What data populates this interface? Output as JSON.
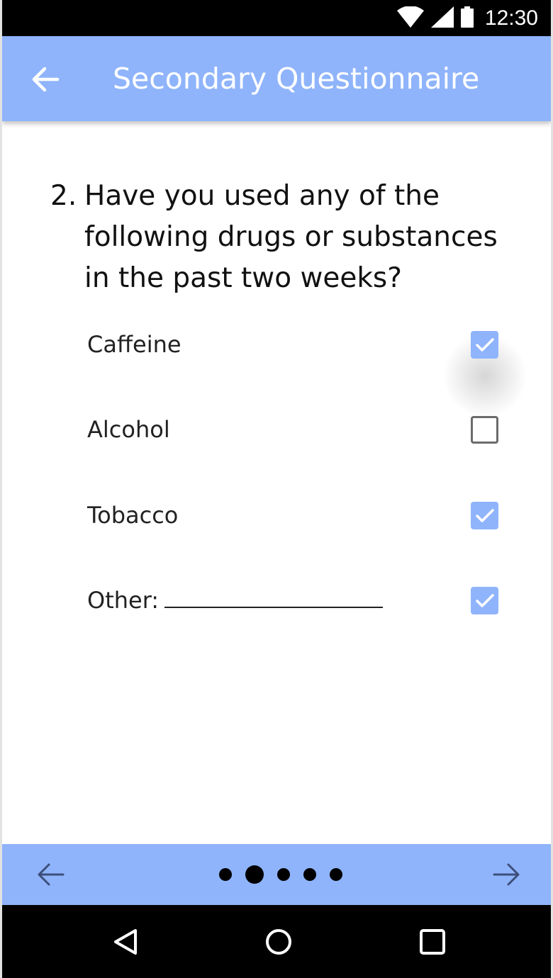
{
  "status_bar": {
    "time": "12:30",
    "icons": [
      "wifi-icon",
      "cellular-signal-icon",
      "battery-icon"
    ]
  },
  "app_bar": {
    "title": "Secondary Questionnaire",
    "back_icon": "arrow-left-icon",
    "color": "#8fb4fb"
  },
  "question": {
    "number": "2.",
    "text": "Have you used any of the following drugs or substances in the past two weeks?"
  },
  "options": [
    {
      "label": "Caffeine",
      "checked": true
    },
    {
      "label": "Alcohol",
      "checked": false
    },
    {
      "label": "Tobacco",
      "checked": true
    },
    {
      "label": "Other:",
      "checked": true,
      "has_blank": true
    }
  ],
  "pager": {
    "prev_icon": "arrow-left-icon",
    "next_icon": "arrow-right-icon",
    "page_count": 5,
    "current_page": 2
  },
  "system_nav": {
    "icons": [
      "back-triangle-icon",
      "home-circle-icon",
      "recents-square-icon"
    ]
  },
  "colors": {
    "accent": "#8fb4fb",
    "checkbox_unchecked_border": "#6b6b6b",
    "system_bars": "#000000"
  }
}
